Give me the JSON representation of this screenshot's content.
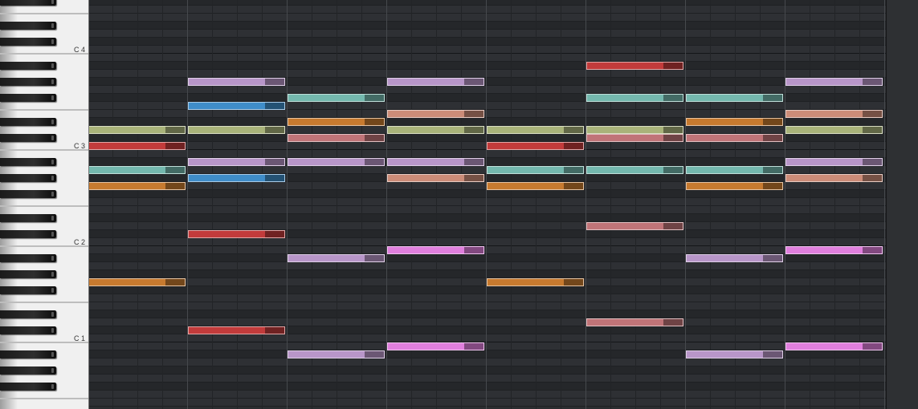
{
  "keyboard": {
    "octave_labels": [
      {
        "name": "C 4",
        "key": 48
      },
      {
        "name": "C 3",
        "key": 36
      },
      {
        "name": "C 2",
        "key": 24
      },
      {
        "name": "C 1",
        "key": 12
      }
    ]
  },
  "grid": {
    "top_key": 54,
    "bottom_key": 4,
    "bars": 8,
    "beats_per_bar": 4
  },
  "notes": [
    {
      "key": 36,
      "bar": 0,
      "color": "#c23b3b"
    },
    {
      "key": 38,
      "bar": 0,
      "color": "#a9b37a"
    },
    {
      "key": 33,
      "bar": 0,
      "color": "#74b8ae"
    },
    {
      "key": 31,
      "bar": 0,
      "color": "#c77a2f"
    },
    {
      "key": 19,
      "bar": 0,
      "color": "#c77a2f"
    },
    {
      "key": 44,
      "bar": 1,
      "color": "#b896c9"
    },
    {
      "key": 41,
      "bar": 1,
      "color": "#3f8dc9"
    },
    {
      "key": 38,
      "bar": 1,
      "color": "#a9b37a"
    },
    {
      "key": 34,
      "bar": 1,
      "color": "#b896c9"
    },
    {
      "key": 32,
      "bar": 1,
      "color": "#3f8dc9"
    },
    {
      "key": 25,
      "bar": 1,
      "color": "#c23b3b"
    },
    {
      "key": 13,
      "bar": 1,
      "color": "#c23b3b"
    },
    {
      "key": 42,
      "bar": 2,
      "color": "#74b8ae"
    },
    {
      "key": 39,
      "bar": 2,
      "color": "#c77a2f"
    },
    {
      "key": 37,
      "bar": 2,
      "color": "#c07478"
    },
    {
      "key": 34,
      "bar": 2,
      "color": "#b896c9"
    },
    {
      "key": 22,
      "bar": 2,
      "color": "#b896c9"
    },
    {
      "key": 10,
      "bar": 2,
      "color": "#b896c9"
    },
    {
      "key": 44,
      "bar": 3,
      "color": "#b896c9"
    },
    {
      "key": 40,
      "bar": 3,
      "color": "#cc8c78"
    },
    {
      "key": 38,
      "bar": 3,
      "color": "#a9b37a"
    },
    {
      "key": 34,
      "bar": 3,
      "color": "#b896c9"
    },
    {
      "key": 32,
      "bar": 3,
      "color": "#cc8c78"
    },
    {
      "key": 23,
      "bar": 3,
      "color": "#e07fdd"
    },
    {
      "key": 11,
      "bar": 3,
      "color": "#e07fdd"
    },
    {
      "key": 38,
      "bar": 4,
      "color": "#a9b37a"
    },
    {
      "key": 36,
      "bar": 4,
      "color": "#c23b3b"
    },
    {
      "key": 33,
      "bar": 4,
      "color": "#74b8ae"
    },
    {
      "key": 31,
      "bar": 4,
      "color": "#c77a2f"
    },
    {
      "key": 19,
      "bar": 4,
      "color": "#c77a2f"
    },
    {
      "key": 46,
      "bar": 5,
      "color": "#c23b3b"
    },
    {
      "key": 42,
      "bar": 5,
      "color": "#74b8ae"
    },
    {
      "key": 38,
      "bar": 5,
      "color": "#a9b37a"
    },
    {
      "key": 37,
      "bar": 5,
      "color": "#c07478"
    },
    {
      "key": 33,
      "bar": 5,
      "color": "#74b8ae"
    },
    {
      "key": 26,
      "bar": 5,
      "color": "#c07478"
    },
    {
      "key": 14,
      "bar": 5,
      "color": "#c07478"
    },
    {
      "key": 42,
      "bar": 6,
      "color": "#74b8ae"
    },
    {
      "key": 39,
      "bar": 6,
      "color": "#c77a2f"
    },
    {
      "key": 37,
      "bar": 6,
      "color": "#c07478"
    },
    {
      "key": 33,
      "bar": 6,
      "color": "#74b8ae"
    },
    {
      "key": 31,
      "bar": 6,
      "color": "#c77a2f"
    },
    {
      "key": 22,
      "bar": 6,
      "color": "#b896c9"
    },
    {
      "key": 10,
      "bar": 6,
      "color": "#b896c9"
    },
    {
      "key": 44,
      "bar": 7,
      "color": "#b896c9"
    },
    {
      "key": 40,
      "bar": 7,
      "color": "#cc8c78"
    },
    {
      "key": 38,
      "bar": 7,
      "color": "#a9b37a"
    },
    {
      "key": 34,
      "bar": 7,
      "color": "#b896c9"
    },
    {
      "key": 32,
      "bar": 7,
      "color": "#cc8c78"
    },
    {
      "key": 23,
      "bar": 7,
      "color": "#e07fdd"
    },
    {
      "key": 11,
      "bar": 7,
      "color": "#e07fdd"
    }
  ]
}
